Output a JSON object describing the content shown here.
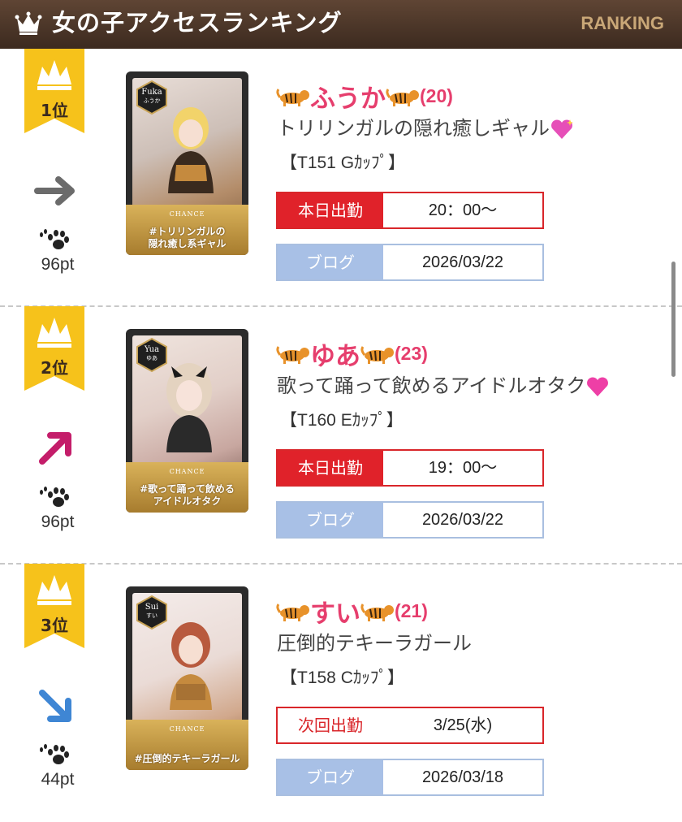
{
  "header": {
    "title": "女の子アクセスランキング",
    "english": "RANKING",
    "icon": "crown-icon"
  },
  "colors": {
    "header_bg": "#4a3428",
    "badge_gold": "#f6c21b",
    "name_pink": "#e63e6d",
    "shift_red": "#e0222a",
    "blog_blue": "#a8c0e6"
  },
  "entries": [
    {
      "rank": "1位",
      "trend": "right-arrow-icon",
      "points": "96pt",
      "card": {
        "hex_name": "Fuka",
        "hex_kana": "ふうか",
        "brand": "CHANCE",
        "caption_1": "#トリリンガルの",
        "caption_2": "隠れ癒し系ギャル"
      },
      "name": "ふうか",
      "age": "(20)",
      "catchphrase": "トリリンガルの隠れ癒しギャル",
      "catch_icon": "sparkling-heart-icon",
      "spec": "【T151 Gｶｯﾌﾟ】",
      "shift_label": "本日出勤",
      "shift_value": "20：00〜",
      "blog_label": "ブログ",
      "blog_date": "2026/03/22"
    },
    {
      "rank": "2位",
      "trend": "up-right-arrow-icon",
      "points": "96pt",
      "card": {
        "hex_name": "Yua",
        "hex_kana": "ゆあ",
        "brand": "CHANCE",
        "caption_1": "#歌って踊って飲める",
        "caption_2": "アイドルオタク"
      },
      "name": "ゆあ",
      "age": "(23)",
      "catchphrase": "歌って踊って飲めるアイドルオタク",
      "catch_icon": "pink-heart-icon",
      "spec": "【T160 Eｶｯﾌﾟ】",
      "shift_label": "本日出勤",
      "shift_value": "19：00〜",
      "blog_label": "ブログ",
      "blog_date": "2026/03/22"
    },
    {
      "rank": "3位",
      "trend": "down-right-arrow-icon",
      "points": "44pt",
      "card": {
        "hex_name": "Sui",
        "hex_kana": "すい",
        "brand": "CHANCE",
        "caption_1": "#圧倒的テキーラガール",
        "caption_2": ""
      },
      "name": "すい",
      "age": "(21)",
      "catchphrase": "圧倒的テキーラガール",
      "catch_icon": "",
      "spec": "【T158 Cｶｯﾌﾟ】",
      "shift_label": "次回出勤",
      "shift_value": "3/25(水)",
      "blog_label": "ブログ",
      "blog_date": "2026/03/18"
    }
  ]
}
